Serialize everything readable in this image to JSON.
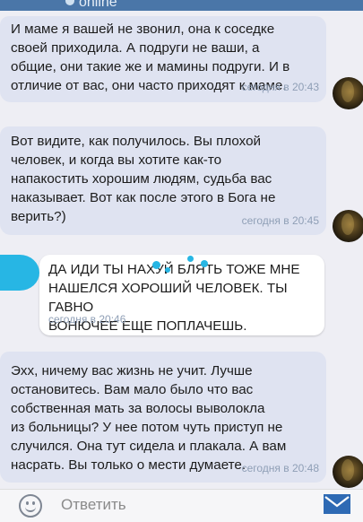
{
  "header": {
    "status": "online"
  },
  "messages": [
    {
      "direction": "in",
      "text": "И маме я вашей не звонил, она к соседке\nсвоей приходила. А подруги не ваши, а\nобщие, они такие же и мамины подруги. И в\nотличие от вас, они часто приходят к маме.",
      "time": "сегодня в 20:43"
    },
    {
      "direction": "in",
      "text": "Вот видите, как получилось. Вы плохой\nчеловек, и когда вы хотите как-то\nнапакостить хорошим людям, судьба вас\nнаказывает. Вот как после этого в Бога не\nверить?)",
      "time": "сегодня в 20:45"
    },
    {
      "direction": "out",
      "text": "ДА ИДИ ТЫ НАХУЙ БЛЯТЬ ТОЖЕ МНЕ\nНАШЕЛСЯ ХОРОШИЙ ЧЕЛОВЕК. ТЫ ГАВНО\nВОНЮЧЕЕ ЕЩЕ ПОПЛАЧЕШЬ.",
      "time": "сегодня в 20:46"
    },
    {
      "direction": "in",
      "text": "Эхх, ничему вас жизнь не учит. Лучше\nостановитесь. Вам мало было что вас\nсобственная мать за волосы выволокла\nиз больницы? У нее потом чуть приступ не\nслучился. Она тут сидела и плакала. А вам\nнасрать. Вы только о мести думаете.",
      "time": "сегодня в 20:48"
    }
  ],
  "composer": {
    "placeholder": "Ответить"
  },
  "icons": {
    "emoji": "smile-icon",
    "send": "send-icon"
  },
  "colors": {
    "incoming_bubble": "#dfe3f1",
    "outgoing_bubble": "#ffffff",
    "accent": "#4a76a8",
    "time": "#8f9fb6"
  }
}
